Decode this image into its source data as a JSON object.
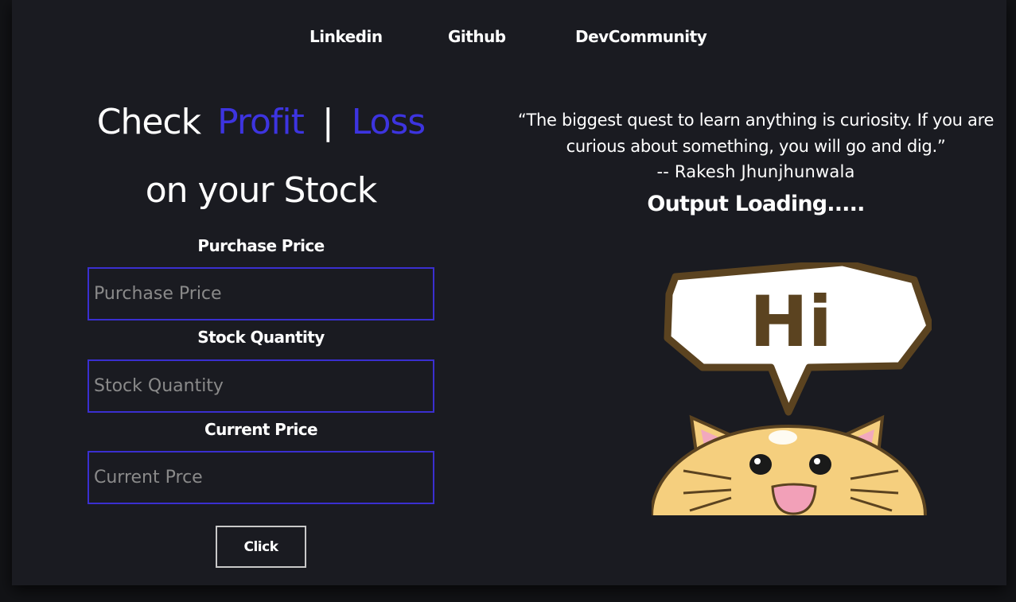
{
  "nav": {
    "links": [
      "Linkedin",
      "Github",
      "DevCommunity"
    ]
  },
  "heading": {
    "check": "Check",
    "profit": "Profit",
    "separator": "|",
    "loss": "Loss",
    "subtitle": "on your Stock"
  },
  "form": {
    "purchase_label": "Purchase Price",
    "purchase_placeholder": "Purchase Price",
    "quantity_label": "Stock Quantity",
    "quantity_placeholder": "Stock Quantity",
    "current_label": "Current Price",
    "current_placeholder": "Current Prce",
    "button_label": "Click"
  },
  "quote": {
    "text": "“The biggest quest to learn anything is curiosity. If you are curious about something, you will go and dig.”",
    "author": "-- Rakesh Jhunjhunwala"
  },
  "output": {
    "status": "Output Loading.....",
    "image_text": "Hi"
  },
  "colors": {
    "accent": "#3d34e0",
    "background": "#1a1b21",
    "field_border": "#3a2fd0"
  }
}
